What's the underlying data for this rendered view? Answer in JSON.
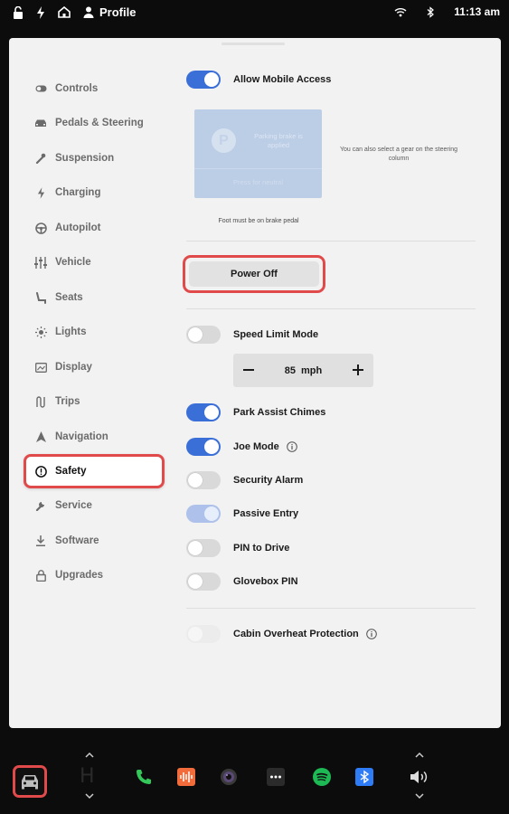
{
  "status_bar": {
    "profile_label": "Profile",
    "time": "11:13 am",
    "icons": [
      "unlock-icon",
      "bolt-icon",
      "home-icon",
      "person-icon",
      "wifi-icon",
      "bluetooth-icon"
    ]
  },
  "sidebar": {
    "items": [
      {
        "label": "Controls",
        "icon": "toggle-icon"
      },
      {
        "label": "Pedals & Steering",
        "icon": "car-icon"
      },
      {
        "label": "Suspension",
        "icon": "wrench-icon"
      },
      {
        "label": "Charging",
        "icon": "bolt-icon"
      },
      {
        "label": "Autopilot",
        "icon": "steering-wheel-icon"
      },
      {
        "label": "Vehicle",
        "icon": "sliders-icon"
      },
      {
        "label": "Seats",
        "icon": "seat-icon"
      },
      {
        "label": "Lights",
        "icon": "sun-icon"
      },
      {
        "label": "Display",
        "icon": "display-icon"
      },
      {
        "label": "Trips",
        "icon": "trips-icon"
      },
      {
        "label": "Navigation",
        "icon": "navigation-arrow-icon"
      },
      {
        "label": "Safety",
        "icon": "alert-circle-icon",
        "active": true
      },
      {
        "label": "Service",
        "icon": "wrench-icon"
      },
      {
        "label": "Software",
        "icon": "download-icon"
      },
      {
        "label": "Upgrades",
        "icon": "lock-icon"
      }
    ]
  },
  "content": {
    "allow_mobile_access": {
      "label": "Allow Mobile Access",
      "on": true
    },
    "parking": {
      "p_glyph": "P",
      "brake_text": "Parking brake is applied",
      "button_text": "Press for neutral",
      "gear_note": "You can also select a gear on the steering column",
      "brake_note": "Foot must be on brake pedal"
    },
    "power_off_label": "Power Off",
    "speed_limit_mode": {
      "label": "Speed Limit Mode",
      "on": false
    },
    "speed_stepper": {
      "value": "85",
      "unit": "mph"
    },
    "park_assist_chimes": {
      "label": "Park Assist Chimes",
      "on": true
    },
    "joe_mode": {
      "label": "Joe Mode",
      "on": true
    },
    "security_alarm": {
      "label": "Security Alarm",
      "on": false
    },
    "passive_entry": {
      "label": "Passive Entry",
      "on": true,
      "dimmed": true
    },
    "pin_to_drive": {
      "label": "PIN to Drive",
      "on": false
    },
    "glovebox_pin": {
      "label": "Glovebox PIN",
      "on": false
    },
    "cabin_overheat": {
      "label": "Cabin Overheat Protection",
      "on": false,
      "dimmed": true
    }
  },
  "dock": {
    "gear_glyphs": "H",
    "apps": [
      "phone-icon",
      "media-icon",
      "camera-icon",
      "more-icon",
      "spotify-icon",
      "bluetooth-icon",
      "volume-icon"
    ]
  },
  "colors": {
    "accent_blue": "#3b6fd8",
    "highlight_red": "#e04a4a",
    "panel_bg": "#f2f2f2",
    "phone_green": "#34c759",
    "spotify_green": "#1db954"
  }
}
